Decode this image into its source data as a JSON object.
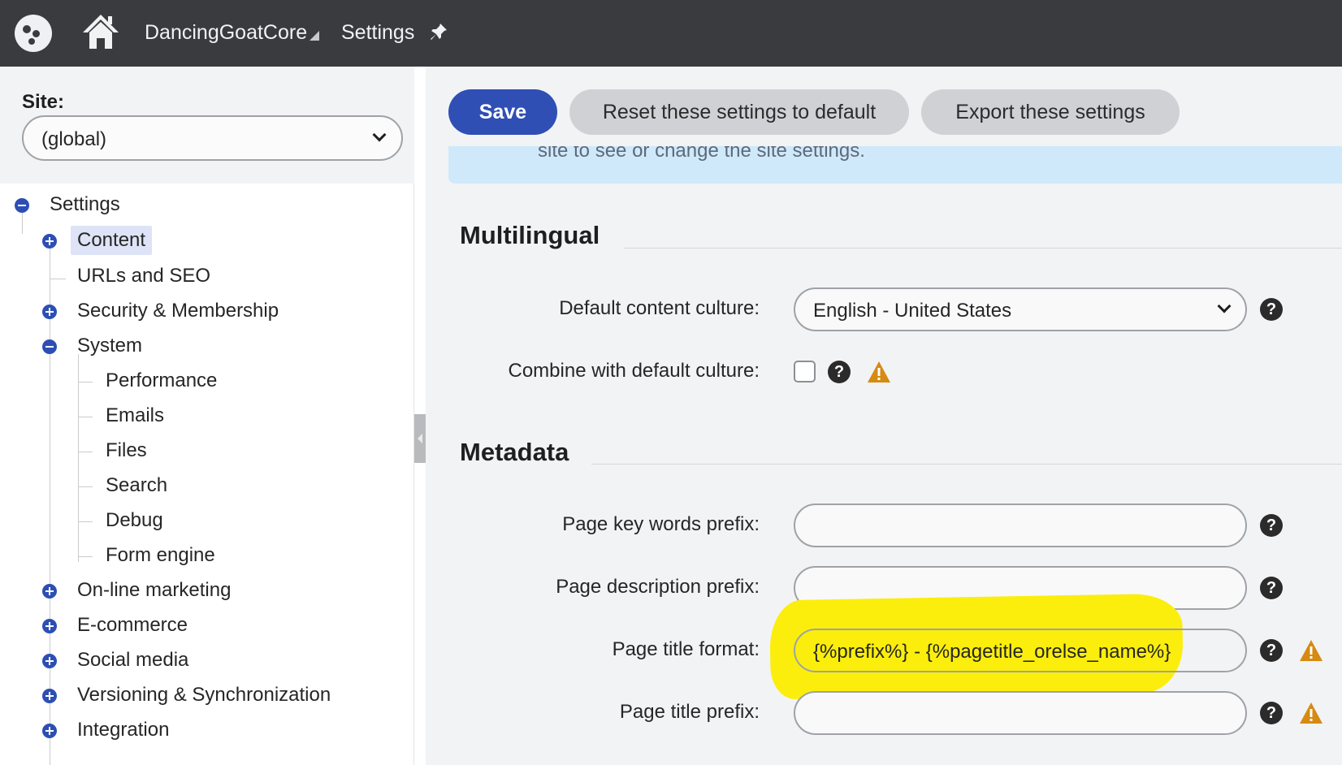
{
  "topbar": {
    "app_name": "DancingGoatCore",
    "module": "Settings",
    "icons": [
      "logo-icon",
      "home-icon",
      "dropdown-triangle-icon",
      "pin-icon"
    ]
  },
  "sidebar": {
    "site_label": "Site:",
    "site_value": "(global)",
    "tree": {
      "root": "Settings",
      "content": "Content",
      "urls": "URLs and SEO",
      "security": "Security & Membership",
      "system": "System",
      "performance": "Performance",
      "emails": "Emails",
      "files": "Files",
      "search": "Search",
      "debug": "Debug",
      "form_engine": "Form engine",
      "online_marketing": "On-line marketing",
      "ecommerce": "E-commerce",
      "social_media": "Social media",
      "versioning": "Versioning & Synchronization",
      "integration": "Integration"
    }
  },
  "toolbar": {
    "save": "Save",
    "reset": "Reset these settings to default",
    "export": "Export these settings"
  },
  "info_text": "site to see or change the site settings.",
  "multilingual": {
    "title": "Multilingual",
    "default_culture_label": "Default content culture:",
    "default_culture_value": "English - United States",
    "combine_label": "Combine with default culture:"
  },
  "metadata": {
    "title": "Metadata",
    "keywords_label": "Page key words prefix:",
    "keywords_value": "",
    "description_label": "Page description prefix:",
    "description_value": "",
    "title_format_label": "Page title format:",
    "title_format_value": "{%prefix%} - {%pagetitle_orelse_name%}",
    "title_prefix_label": "Page title prefix:",
    "title_prefix_value": ""
  },
  "colors": {
    "topbar": "#393b3e",
    "primary": "#2f4fb5",
    "highlight": "#fbee0c",
    "warning": "#d78a12"
  },
  "help_glyph": "?"
}
